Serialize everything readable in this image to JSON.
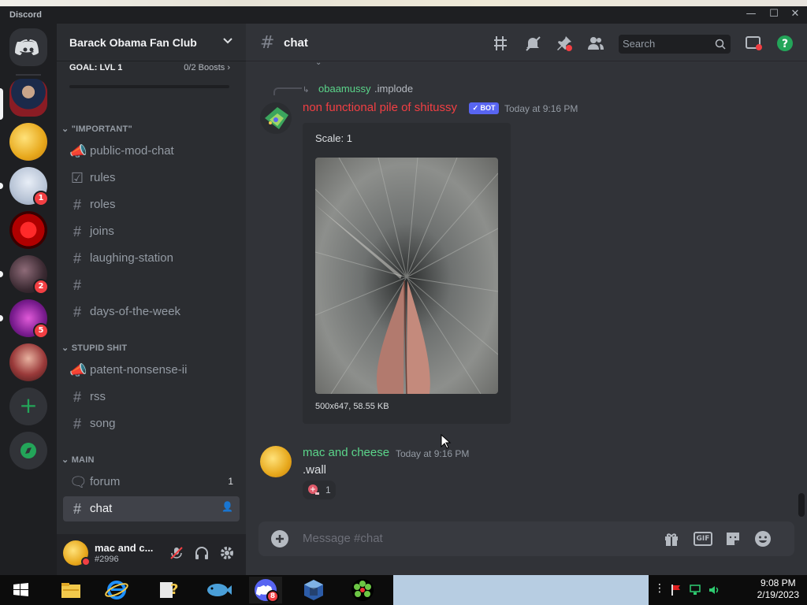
{
  "window": {
    "app_name": "Discord"
  },
  "server": {
    "name": "Barack Obama Fan Club",
    "goal_label": "GOAL: LVL 1",
    "boosts": "0/2 Boosts"
  },
  "rail": {
    "badges": {
      "s3": "1",
      "s5": "2",
      "s6": "5"
    }
  },
  "categories": {
    "important": "\"IMPORTANT\"",
    "stupid": "STUPID SHIT",
    "main": "MAIN"
  },
  "channels": {
    "c1": "public-mod-chat",
    "c2": "rules",
    "c3": "roles",
    "c4": "joins",
    "c5": "laughing-station",
    "c6": "",
    "c7": "days-of-the-week",
    "c8": "patent-nonsense-ii",
    "c9": "rss",
    "c10": "song",
    "c11": "forum",
    "c11_count": "1",
    "c12": "chat"
  },
  "user": {
    "name": "mac and c...",
    "tag": "#2996"
  },
  "header": {
    "channel": "chat",
    "search_placeholder": "Search"
  },
  "messages": {
    "reply": {
      "user": "obaamussy",
      "text": ".implode"
    },
    "m1": {
      "author": "non functional pile of shitussy",
      "bot_tag": "✓ BOT",
      "time": "Today at 9:16 PM",
      "embed_title": "Scale: 1",
      "embed_info": "500x647, 58.55 KB"
    },
    "m2": {
      "author": "mac and cheese",
      "time": "Today at 9:16 PM",
      "text": ".wall",
      "reaction_count": "1"
    }
  },
  "composer": {
    "placeholder": "Message #chat",
    "gif_label": "GIF"
  },
  "taskbar": {
    "time": "9:08 PM",
    "date": "2/19/2023",
    "discord_badge": "8"
  },
  "colors": {
    "accent": "#5865f2",
    "bot_author": "#f23f43",
    "reply_user": "#5bd58a",
    "m2_author": "#5bd58a"
  }
}
